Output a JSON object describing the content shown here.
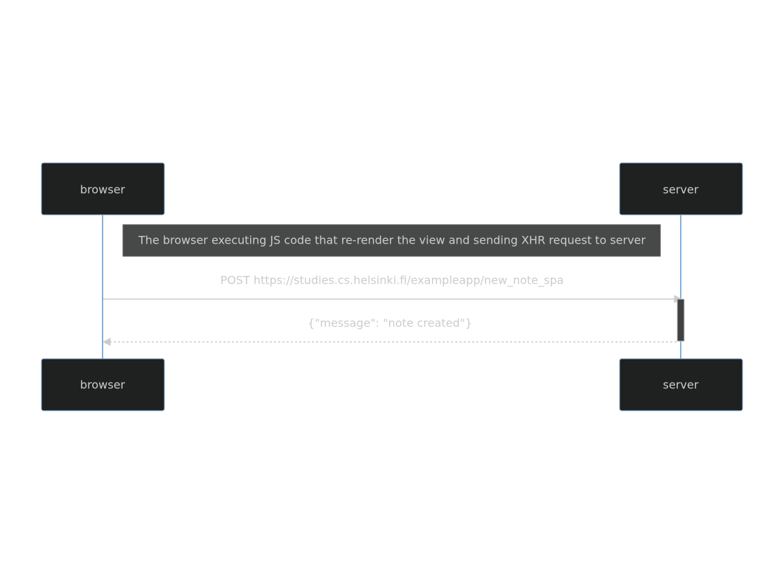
{
  "participants": [
    {
      "id": "browser",
      "label": "browser"
    },
    {
      "id": "server",
      "label": "server"
    }
  ],
  "note": {
    "text": "The browser executing JS code that re-render the view and sending XHR request to server"
  },
  "messages": [
    {
      "from": "browser",
      "to": "server",
      "text": "POST https://studies.cs.helsinki.fi/exampleapp/new_note_spa",
      "style": "solid"
    },
    {
      "from": "server",
      "to": "browser",
      "text": "{\"message\": \"note created\"}",
      "style": "dotted"
    }
  ],
  "colors": {
    "actor_fill": "#1f2020",
    "actor_border": "#81b1db",
    "lifeline": "#81b1db",
    "note_fill": "#474949",
    "text": "#cccccc",
    "activation_fill": "#3f4142"
  }
}
